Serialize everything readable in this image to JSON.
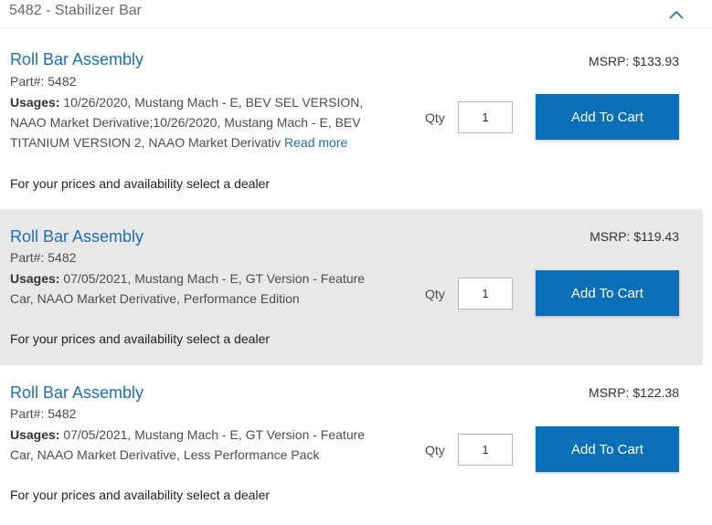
{
  "section": {
    "title": "5482 - Stabilizer Bar"
  },
  "products": [
    {
      "title": "Roll Bar Assembly",
      "part": "Part#: 5482",
      "usages_label": "Usages:",
      "usages_text": " 10/26/2020, Mustang Mach - E, BEV SEL VERSION, NAAO Market Derivative;10/26/2020, Mustang Mach - E, BEV TITANIUM VERSION 2, NAAO Market Derivativ",
      "read_more": "Read more",
      "dealer_note": "For your prices and availability select a dealer",
      "msrp_label": "MSRP:",
      "msrp_value": "$133.93",
      "qty_label": "Qty",
      "qty_value": "1",
      "button_label": "Add To Cart"
    },
    {
      "title": "Roll Bar Assembly",
      "part": "Part#: 5482",
      "usages_label": "Usages:",
      "usages_text": " 07/05/2021, Mustang Mach - E, GT Version - Feature Car, NAAO Market Derivative, Performance Edition",
      "dealer_note": "For your prices and availability select a dealer",
      "msrp_label": "MSRP:",
      "msrp_value": "$119.43",
      "qty_label": "Qty",
      "qty_value": "1",
      "button_label": "Add To Cart"
    },
    {
      "title": "Roll Bar Assembly",
      "part": "Part#: 5482",
      "usages_label": "Usages:",
      "usages_text": " 07/05/2021, Mustang Mach - E, GT Version - Feature Car, NAAO Market Derivative, Less Performance Pack",
      "dealer_note": "For your prices and availability select a dealer",
      "msrp_label": "MSRP:",
      "msrp_value": "$122.38",
      "qty_label": "Qty",
      "qty_value": "1",
      "button_label": "Add To Cart"
    }
  ],
  "colors": {
    "link": "#1f6fad",
    "button": "#0b6fb8",
    "alt_row": "#e8e8e8"
  },
  "icons": {
    "collapse": "chevron-up-icon"
  }
}
